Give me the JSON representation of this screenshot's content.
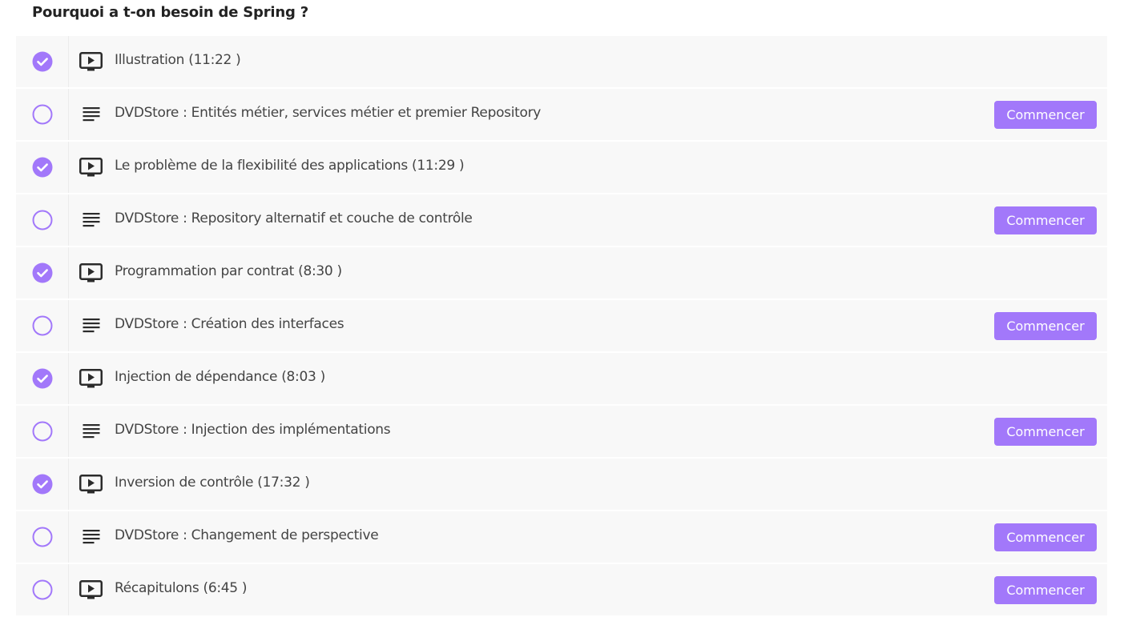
{
  "section": {
    "title": "Pourquoi a t-on besoin de Spring ?"
  },
  "colors": {
    "accent": "#a278fa",
    "row_background": "#f8f8f8",
    "text": "#444444"
  },
  "lectures": [
    {
      "name": "Illustration (11:22 )",
      "type": "video",
      "completed": true,
      "button": ""
    },
    {
      "name": "DVDStore : Entités métier, services métier et premier Repository",
      "type": "text",
      "completed": false,
      "button": "Commencer"
    },
    {
      "name": "Le problème de la flexibilité des applications (11:29 )",
      "type": "video",
      "completed": true,
      "button": ""
    },
    {
      "name": "DVDStore : Repository alternatif et couche de contrôle",
      "type": "text",
      "completed": false,
      "button": "Commencer"
    },
    {
      "name": "Programmation par contrat (8:30 )",
      "type": "video",
      "completed": true,
      "button": ""
    },
    {
      "name": "DVDStore : Création des interfaces",
      "type": "text",
      "completed": false,
      "button": "Commencer"
    },
    {
      "name": "Injection de dépendance (8:03 )",
      "type": "video",
      "completed": true,
      "button": ""
    },
    {
      "name": "DVDStore : Injection des implémentations",
      "type": "text",
      "completed": false,
      "button": "Commencer"
    },
    {
      "name": "Inversion de contrôle (17:32 )",
      "type": "video",
      "completed": true,
      "button": ""
    },
    {
      "name": "DVDStore : Changement de perspective",
      "type": "text",
      "completed": false,
      "button": "Commencer"
    },
    {
      "name": "Récapitulons (6:45 )",
      "type": "video",
      "completed": false,
      "button": "Commencer"
    }
  ]
}
